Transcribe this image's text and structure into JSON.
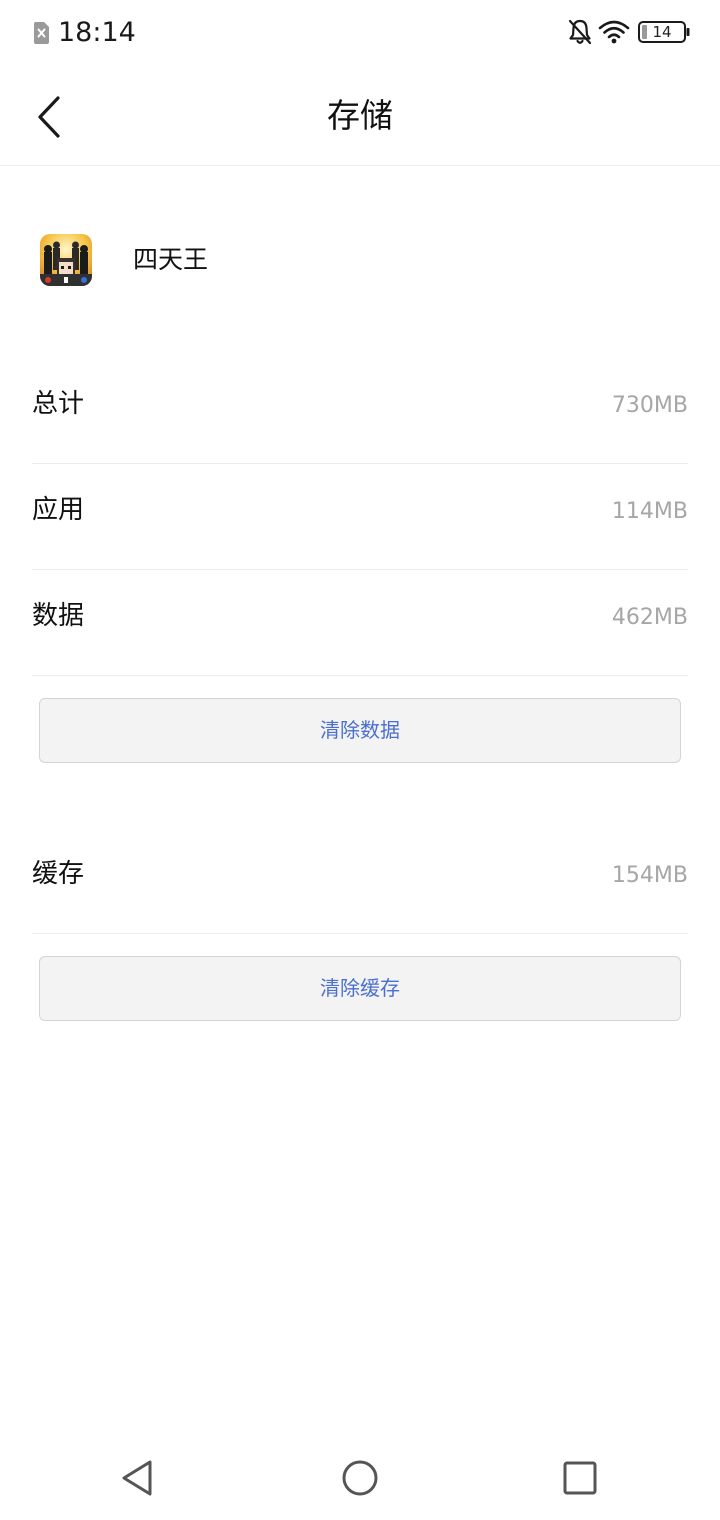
{
  "status_bar": {
    "time": "18:14",
    "battery_level": "14",
    "icons": [
      "sim-missing-icon",
      "bell-off-icon",
      "wifi-icon",
      "battery-icon"
    ]
  },
  "app_bar": {
    "back_icon": "chevron-left-icon",
    "title": "存储"
  },
  "app": {
    "name": "四天王",
    "icon": "app-icon"
  },
  "storage": {
    "total": {
      "label": "总计",
      "value": "730MB"
    },
    "app": {
      "label": "应用",
      "value": "114MB"
    },
    "data": {
      "label": "数据",
      "value": "462MB"
    },
    "clear_data_label": "清除数据",
    "cache": {
      "label": "缓存",
      "value": "154MB"
    },
    "clear_cache_label": "清除缓存"
  },
  "nav_bar": {
    "icons": [
      "nav-back-icon",
      "nav-home-icon",
      "nav-recents-icon"
    ]
  },
  "colors": {
    "accent": "#4b6fcf",
    "secondary_text": "#a6a6a6",
    "divider": "#ececec",
    "button_bg": "#f3f3f3"
  }
}
